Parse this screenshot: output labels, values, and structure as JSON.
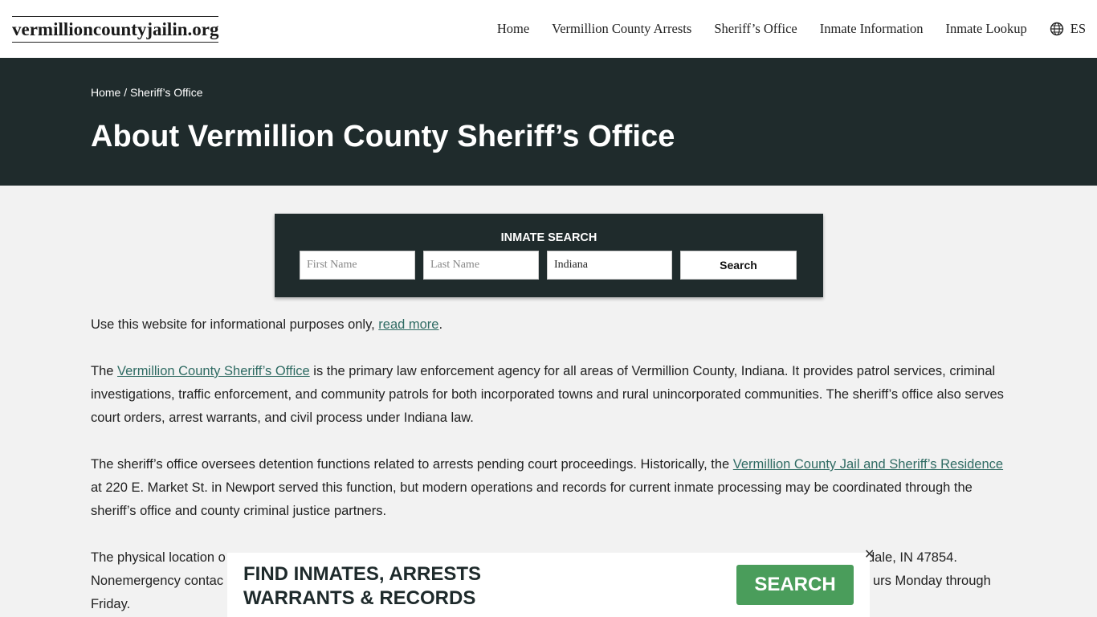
{
  "site": {
    "logo": "vermillioncountyjailin.org"
  },
  "nav": {
    "items": [
      "Home",
      "Vermillion County Arrests",
      "Sheriff’s Office",
      "Inmate Information",
      "Inmate Lookup"
    ],
    "lang": "ES"
  },
  "hero": {
    "breadcrumb_home": "Home",
    "breadcrumb_sep": " / ",
    "breadcrumb_current": "Sheriff’s Office",
    "title": "About Vermillion County Sheriff’s Office"
  },
  "search": {
    "title": "INMATE SEARCH",
    "first_placeholder": "First Name",
    "last_placeholder": "Last Name",
    "state_value": "Indiana",
    "button": "Search"
  },
  "content": {
    "p1_text": "Use this website for informational purposes only, ",
    "p1_link": "read more",
    "p1_end": ".",
    "p2_pre": "The ",
    "p2_link": "Vermillion County Sheriff’s Office",
    "p2_text": " is the primary law enforcement agency for all areas of Vermillion County, Indiana. It provides patrol services, criminal investigations, traffic enforcement, and community patrols for both incorporated towns and rural unincorporated communities. The sheriff’s office also serves court orders, arrest warrants, and civil process under Indiana law.",
    "p3_pre": "The sheriff’s office oversees detention functions related to arrests pending court proceedings. Historically, the ",
    "p3_link": "Vermillion County Jail and Sheriff’s Residence",
    "p3_text": " at 220 E. Market St. in Newport served this function, but modern operations and records for current inmate processing may be coordinated through the sheriff’s office and county criminal justice partners.",
    "p4_a": "The physical location o",
    "p4_b": "dale, IN 47854.",
    "p4_c": "Nonemergency contac",
    "p4_d": "urs Monday through",
    "p4_e": "Friday."
  },
  "promo": {
    "line1": "FIND INMATES, ARRESTS",
    "line2": "WARRANTS & RECORDS",
    "button": "SEARCH",
    "close": "✕"
  }
}
